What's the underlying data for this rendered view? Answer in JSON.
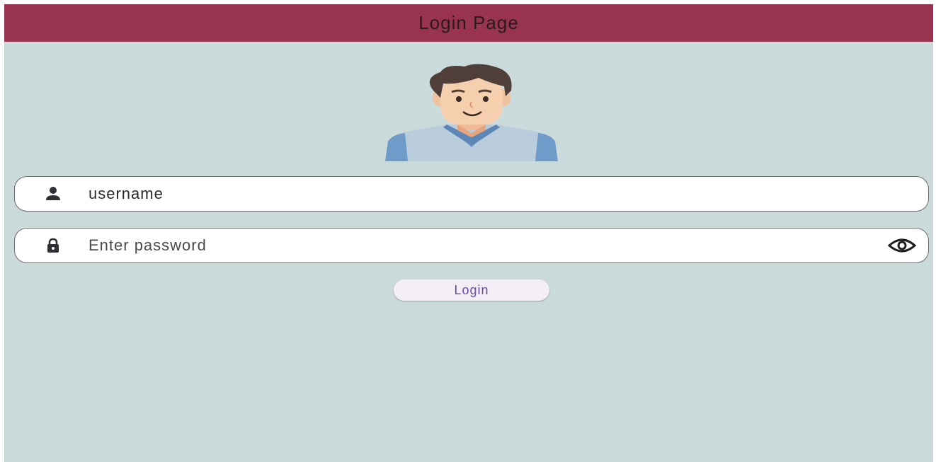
{
  "app_bar": {
    "title": "Login Page"
  },
  "avatar": {
    "icon": "user-avatar-illustration"
  },
  "username_field": {
    "value": "username",
    "placeholder": "",
    "icon": "person-icon"
  },
  "password_field": {
    "value": "",
    "placeholder": "Enter password",
    "icon": "lock-icon",
    "toggle_icon": "eye-icon"
  },
  "login_button": {
    "label": "Login"
  },
  "colors": {
    "app_bar": "#983450",
    "background": "#cbdbdb",
    "field_background": "#ffffff",
    "button_background": "#f4eef6",
    "button_text": "#6a4aa8"
  }
}
